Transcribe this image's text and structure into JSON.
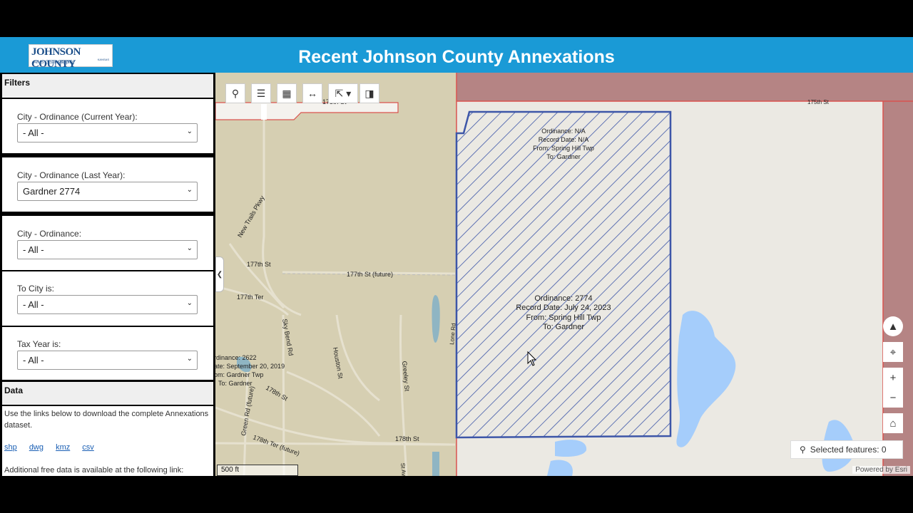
{
  "header": {
    "title": "Recent Johnson County Annexations",
    "logo_main": "JOHNSON COUNTY",
    "logo_state": "KANSAS",
    "logo_sub": "AIMS GIS & Mapping"
  },
  "sidebar": {
    "filters_heading": "Filters",
    "filters": [
      {
        "label": "City - Ordinance (Current Year):",
        "value": "- All -"
      },
      {
        "label": "City - Ordinance (Last Year):",
        "value": "Gardner 2774"
      },
      {
        "label": "City - Ordinance:",
        "value": "- All -"
      },
      {
        "label": "To City is:",
        "value": "- All -"
      },
      {
        "label": "Tax Year is:",
        "value": "- All -"
      }
    ],
    "data_heading": "Data",
    "data_text": "Use the links below to download the complete Annexations dataset.",
    "links": [
      "shp",
      "dwg",
      "kmz",
      "csv"
    ],
    "more_text": "Additional free data is available at the following link:"
  },
  "map": {
    "selected_features": "Selected features: 0",
    "scale": "500 ft",
    "powered": "Powered by Esri",
    "colors": {
      "parcel_stroke": "#3d56a8",
      "annex_fill": "#b58484",
      "water": "#a5cdfb",
      "road_red": "#d9534f"
    },
    "labels": {
      "annex_main": [
        "Ordinance: 2774",
        "Record Date: July 24, 2023",
        "From: Spring Hill Twp",
        "To: Gardner"
      ],
      "annex_top": [
        "Ordinance: N/A",
        "Record Date: N/A",
        "From: Spring Hill Twp",
        "To: Gardner"
      ],
      "annex_left": [
        "rdinance: 2622",
        "ate: September 20, 2019",
        "om: Gardner Twp",
        "To: Gardner"
      ],
      "roads": {
        "r175_left": "175th St",
        "r175_right": "175th St",
        "r177": "177th St",
        "r177f": "177th St (future)",
        "r177t": "177th Ter",
        "newtrails": "New Trails Pkwy",
        "sky": "Sky Bend Rd",
        "houston": "Houston St",
        "greeley": "Greeley St",
        "r178": "178th St",
        "r178b": "178th St",
        "r178t": "178th Ter (future)",
        "green": "Green Rd (future)",
        "st_av": "St Av",
        "lone": "Lone Rd"
      }
    }
  }
}
